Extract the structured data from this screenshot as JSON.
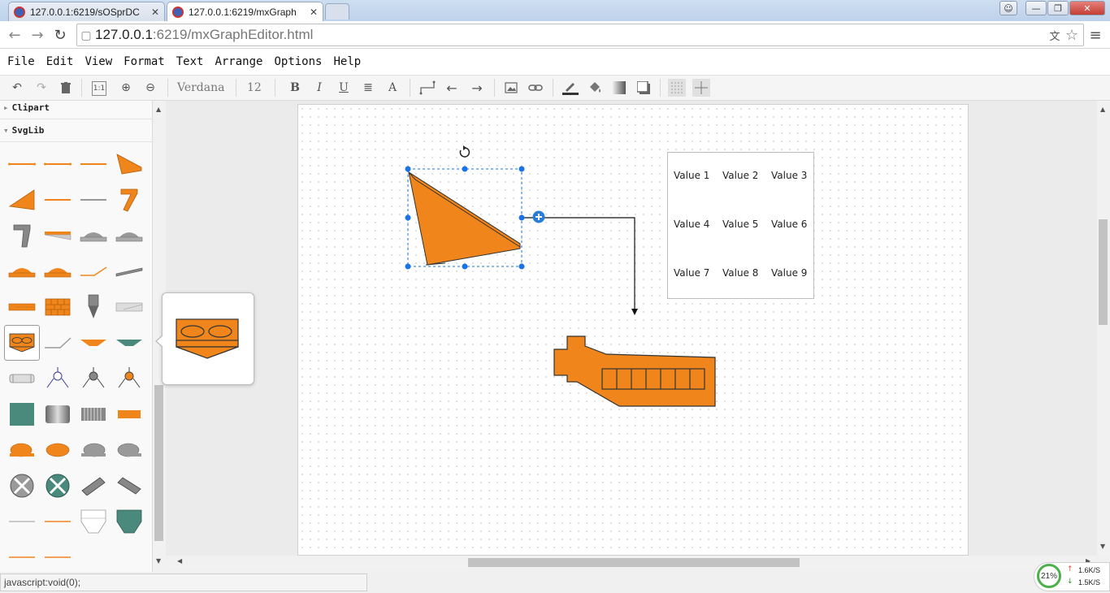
{
  "browser": {
    "tabs": [
      {
        "title": "127.0.0.1:6219/sOSprDC"
      },
      {
        "title": "127.0.0.1:6219/mxGraph"
      }
    ],
    "url_host": "127.0.0.1",
    "url_rest": ":6219/mxGraphEditor.html",
    "status_text": "javascript:void(0);",
    "net": {
      "cpu": "21%",
      "up": "1.6K/S",
      "down": "1.5K/S"
    }
  },
  "menu": [
    "File",
    "Edit",
    "View",
    "Format",
    "Text",
    "Arrange",
    "Options",
    "Help"
  ],
  "toolbar": {
    "font": "Verdana",
    "size": "12",
    "bold": "B",
    "italic": "I",
    "underline": "U",
    "text_icon": "A",
    "actual_size": "1:1"
  },
  "sidebar": {
    "sections": [
      "Clipart",
      "SvgLib"
    ]
  },
  "table": {
    "rows": [
      [
        "Value 1",
        "Value 2",
        "Value 3"
      ],
      [
        "Value 4",
        "Value 5",
        "Value 6"
      ],
      [
        "Value 7",
        "Value 8",
        "Value 9"
      ]
    ]
  },
  "colors": {
    "orange": "#f0861b",
    "teal": "#4a8a7d",
    "gray": "#8c8c8c",
    "selection": "#1a73e8"
  }
}
